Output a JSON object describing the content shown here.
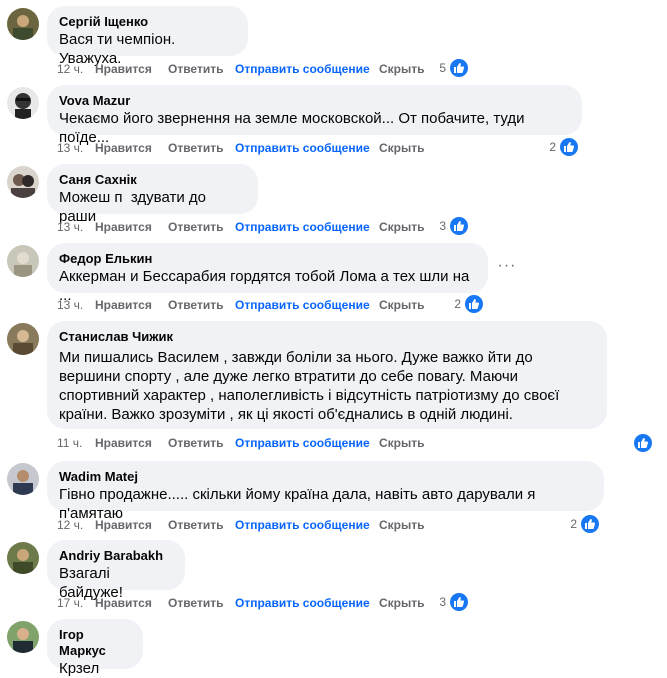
{
  "actions": {
    "like": "Нравится",
    "reply": "Ответить",
    "send_message": "Отправить сообщение",
    "hide": "Скрыть"
  },
  "colors": {
    "bubble": "#f0f2f5",
    "link": "#0866ff",
    "like": "#1877f2",
    "muted": "#65676b"
  },
  "comments": [
    {
      "author": "Сергій Іщенко",
      "text": "Вася ти чемпіон. Уважуха.",
      "time": "12 ч.",
      "reactions": "5"
    },
    {
      "author": "Vova Mazur",
      "text": "Чекаємо його звернення на земле московской... От побачите, туди поїде...",
      "time": "13 ч.",
      "reactions": "2"
    },
    {
      "author": "Саня Сахнік",
      "text": "Можеш п  здувати до раши",
      "time": "13 ч.",
      "reactions": "3"
    },
    {
      "author": "Федор Елькин",
      "text": "Аккерман и Бессарабия гордятся тобой Лома а тех шли на ...",
      "time": "13 ч.",
      "reactions": "2"
    },
    {
      "author": "Станислав Чижик",
      "text": "Ми пишались Василем , завжди боліли за нього. Дуже важко йти до вершини спорту , але дуже легко втратити до себе повагу. Маючи спортивний характер , наполегливість і відсутність патріотизму до своєї країни. Важко зрозуміти , як ці якості об'єднались в одній людині.",
      "time": "11 ч.",
      "reactions": ""
    },
    {
      "author": "Wadim Matej",
      "text": "Гівно продажне..... скільки йому країна дала, навіть авто дарували я п'амятаю",
      "time": "12 ч.",
      "reactions": "2"
    },
    {
      "author": "Andriy Barabakh",
      "text": "Взагалі байдуже!",
      "time": "17 ч.",
      "reactions": "3"
    },
    {
      "author": "Ігор Маркус",
      "text": "Крзел",
      "time": "",
      "reactions": ""
    }
  ]
}
